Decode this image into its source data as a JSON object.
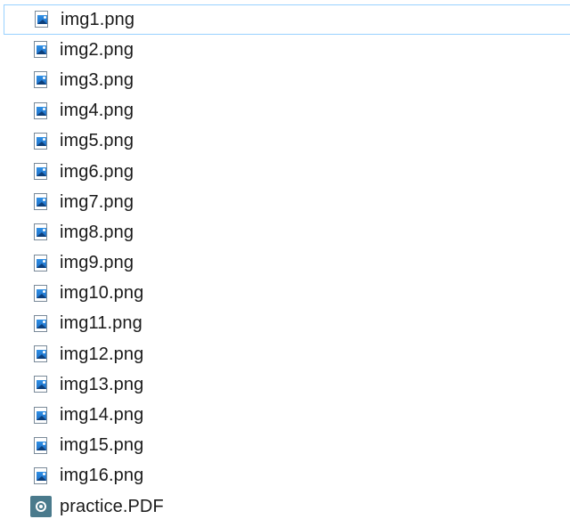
{
  "files": [
    {
      "name": "img1.png",
      "icon": "image-file-icon"
    },
    {
      "name": "img2.png",
      "icon": "image-file-icon"
    },
    {
      "name": "img3.png",
      "icon": "image-file-icon"
    },
    {
      "name": "img4.png",
      "icon": "image-file-icon"
    },
    {
      "name": "img5.png",
      "icon": "image-file-icon"
    },
    {
      "name": "img6.png",
      "icon": "image-file-icon"
    },
    {
      "name": "img7.png",
      "icon": "image-file-icon"
    },
    {
      "name": "img8.png",
      "icon": "image-file-icon"
    },
    {
      "name": "img9.png",
      "icon": "image-file-icon"
    },
    {
      "name": "img10.png",
      "icon": "image-file-icon"
    },
    {
      "name": "img11.png",
      "icon": "image-file-icon"
    },
    {
      "name": "img12.png",
      "icon": "image-file-icon"
    },
    {
      "name": "img13.png",
      "icon": "image-file-icon"
    },
    {
      "name": "img14.png",
      "icon": "image-file-icon"
    },
    {
      "name": "img15.png",
      "icon": "image-file-icon"
    },
    {
      "name": "img16.png",
      "icon": "image-file-icon"
    },
    {
      "name": "practice.PDF",
      "icon": "pdf-file-icon"
    }
  ],
  "colors": {
    "hover_border": "#99d1ff",
    "image_icon_blue": "#1f6fc4",
    "pdf_icon_teal": "#4a7a8c"
  }
}
